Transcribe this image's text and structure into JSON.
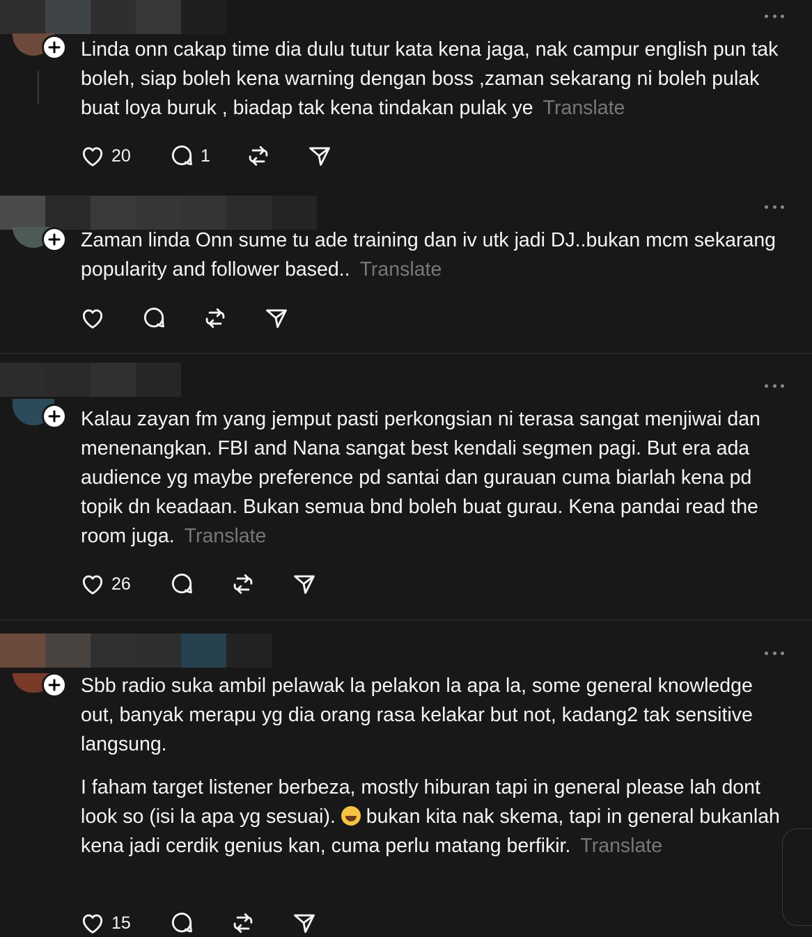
{
  "posts": [
    {
      "text_paragraphs": [
        "Linda onn cakap time dia dulu tutur kata kena jaga, nak campur english pun tak boleh, siap boleh kena warning dengan boss ,zaman sekarang ni boleh pulak buat loya buruk , biadap tak kena tindakan pulak ye"
      ],
      "translate": "Translate",
      "likes": "20",
      "replies": "1"
    },
    {
      "text_paragraphs": [
        "Zaman linda Onn sume tu ade training dan iv utk jadi DJ..bukan mcm sekarang popularity and follower based.."
      ],
      "translate": "Translate"
    },
    {
      "text_paragraphs": [
        "Kalau zayan fm yang jemput pasti perkongsian ni terasa sangat menjiwai dan menenangkan. FBI and Nana sangat best kendali segmen pagi. But era ada audience yg maybe preference pd santai dan gurauan cuma biarlah kena pd topik dn keadaan. Bukan semua bnd boleh buat gurau. Kena pandai read the room juga."
      ],
      "translate": "Translate",
      "likes": "26"
    },
    {
      "text_paragraphs": [
        "Sbb radio suka ambil pelawak la pelakon la apa la, some general knowledge out, banyak merapu yg dia orang rasa kelakar but not, kadang2 tak sensitive langsung.",
        "I faham target listener berbeza, mostly hiburan tapi in general please lah dont look so (isi la apa yg sesuai).",
        "bukan kita nak skema, tapi in general bukanlah kena jadi cerdik genius kan, cuma perlu matang berfikir."
      ],
      "emoji": "laughing-tears-emoji",
      "translate": "Translate",
      "likes": "15"
    }
  ],
  "icons": {
    "like": "heart-icon",
    "reply": "speech-bubble-icon",
    "repost": "repost-icon",
    "share": "paper-plane-icon",
    "more": "more-dots-icon",
    "follow": "plus-icon"
  },
  "colors": {
    "background": "#181818",
    "text": "#f3f5f7",
    "muted": "#777777",
    "divider": "#323232"
  }
}
